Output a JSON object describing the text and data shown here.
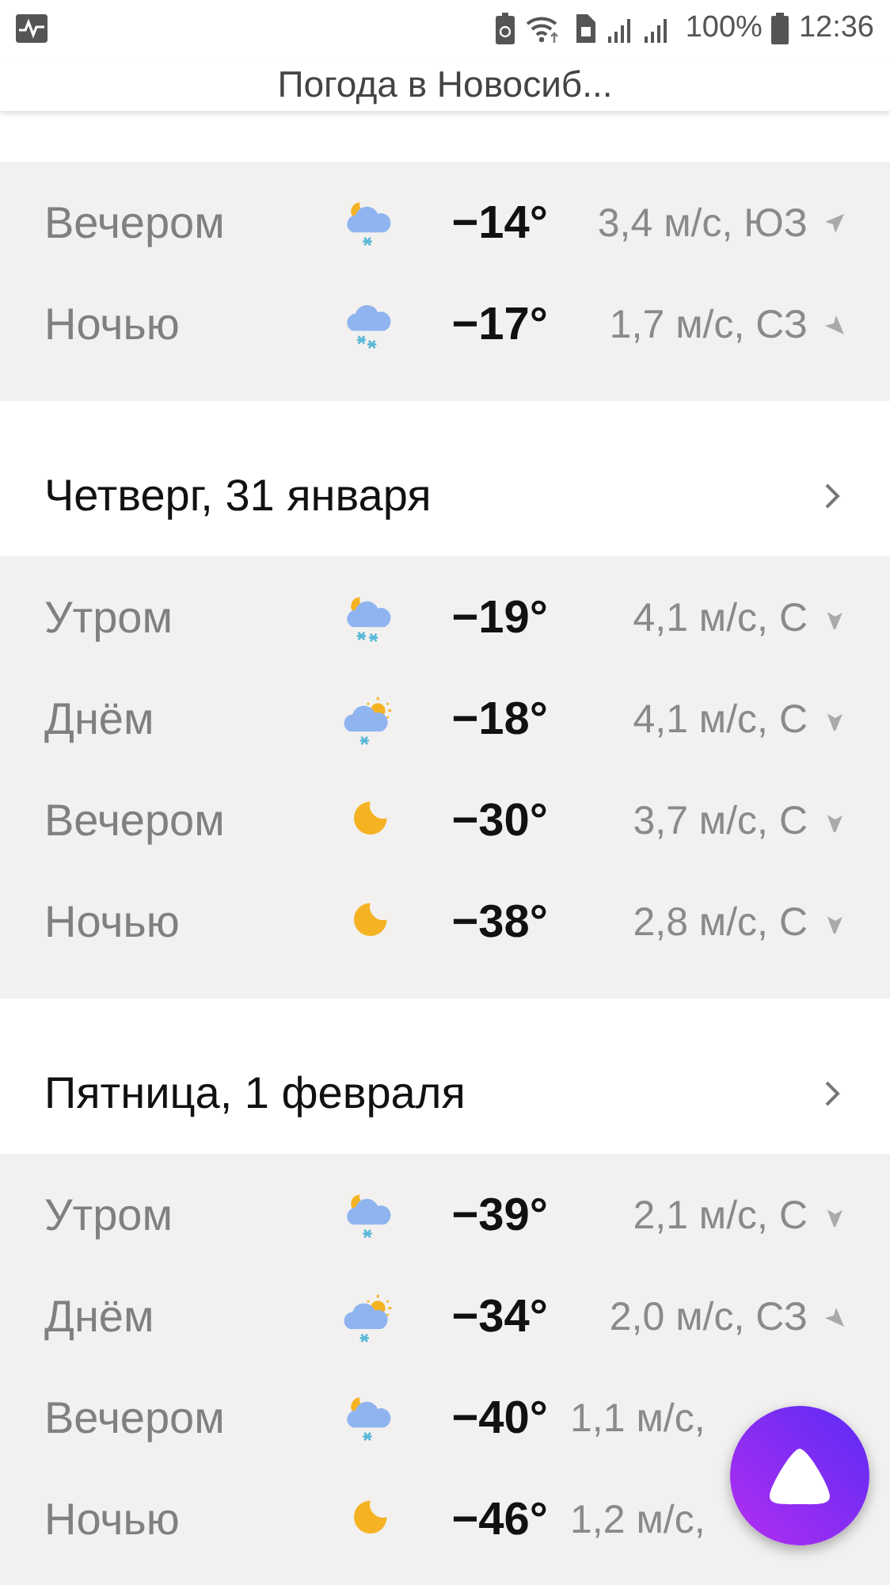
{
  "status_bar": {
    "battery": "100%",
    "time": "12:36"
  },
  "header": {
    "title": "Погода в Новосиб..."
  },
  "days": [
    {
      "rows": [
        {
          "label": "Вечером",
          "kind": "night-snow",
          "temp": "−14°",
          "wind": "3,4 м/с, ЮЗ",
          "wind_arrow": {
            "kind": "sw"
          }
        },
        {
          "label": "Ночью",
          "kind": "snow",
          "temp": "−17°",
          "wind": "1,7 м/с, СЗ",
          "wind_arrow": {
            "kind": "nw"
          }
        }
      ]
    },
    {
      "title": "Четверг, 31 января",
      "rows": [
        {
          "label": "Утром",
          "kind": "night-heavy-snow",
          "temp": "−19°",
          "wind": "4,1 м/с, С",
          "wind_arrow": {
            "kind": "n"
          }
        },
        {
          "label": "Днём",
          "kind": "day-snow",
          "temp": "−18°",
          "wind": "4,1 м/с, С",
          "wind_arrow": {
            "kind": "n"
          }
        },
        {
          "label": "Вечером",
          "kind": "night-clear",
          "temp": "−30°",
          "wind": "3,7 м/с, С",
          "wind_arrow": {
            "kind": "n"
          }
        },
        {
          "label": "Ночью",
          "kind": "night-clear",
          "temp": "−38°",
          "wind": "2,8 м/с, С",
          "wind_arrow": {
            "kind": "n"
          }
        }
      ]
    },
    {
      "title": "Пятница, 1 февраля",
      "rows": [
        {
          "label": "Утром",
          "kind": "night-snow",
          "temp": "−39°",
          "wind": "2,1 м/с, С",
          "wind_arrow": {
            "kind": "n"
          }
        },
        {
          "label": "Днём",
          "kind": "day-snow",
          "temp": "−34°",
          "wind": "2,0 м/с, СЗ",
          "wind_arrow": {
            "kind": "nw"
          }
        },
        {
          "label": "Вечером",
          "kind": "night-snow",
          "temp": "−40°",
          "wind": "1,1 м/с,"
        },
        {
          "label": "Ночью",
          "kind": "night-clear",
          "temp": "−46°",
          "wind": "1,2 м/с,"
        }
      ]
    }
  ]
}
